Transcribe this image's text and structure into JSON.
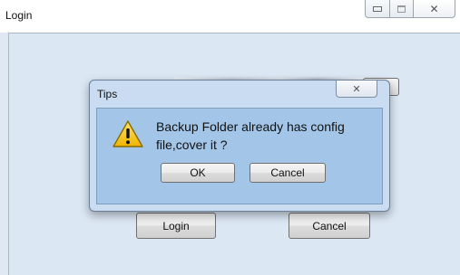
{
  "main_window": {
    "title": "Login",
    "login_button": "Login",
    "cancel_button": "Cancel"
  },
  "dialog": {
    "title": "Tips",
    "message_line1": "Backup Folder already has config",
    "message_line2": "file,cover it ?",
    "ok_button": "OK",
    "cancel_button": "Cancel",
    "icon": "warning-icon"
  },
  "colors": {
    "client_background": "#dce7f4",
    "dialog_body": "#a3c6e8",
    "dialog_frame": "#c9dcf1",
    "warning_yellow": "#f5c400"
  }
}
